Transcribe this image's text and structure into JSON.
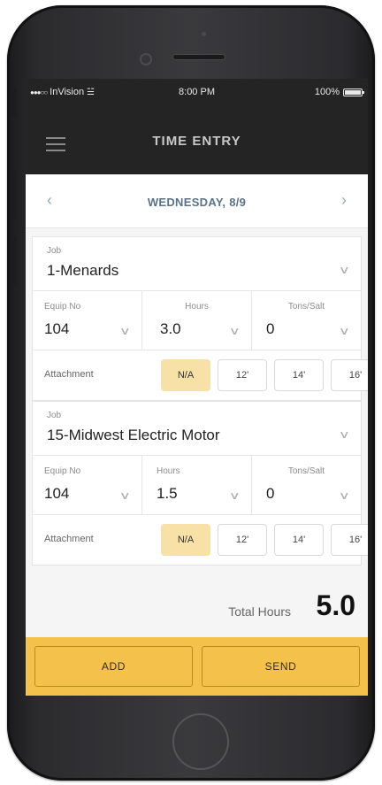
{
  "status_bar": {
    "carrier": "InVision",
    "signal_glyph": "●●●○○",
    "time": "8:00 PM",
    "battery": "100%"
  },
  "nav": {
    "title": "TIME ENTRY",
    "menu_icon": "hamburger-menu-icon"
  },
  "date_row": {
    "label": "WEDNESDAY, 8/9",
    "prev_glyph": "‹",
    "next_glyph": "›"
  },
  "entries": [
    {
      "job_label": "Job",
      "job_value": "1-Menards",
      "equip_label": "Equip No",
      "equip_value": "104",
      "hours_label": "Hours",
      "hours_value": "3.0",
      "tons_label": "Tons/Salt",
      "tons_value": "0",
      "attachment_label": "Attachment",
      "options": [
        "N/A",
        "12'",
        "14'",
        "16'"
      ],
      "selected": "N/A"
    },
    {
      "job_label": "Job",
      "job_value": "15-Midwest Electric Motor",
      "equip_label": "Equip No",
      "equip_value": "104",
      "hours_label": "Hours",
      "hours_value": "1.5",
      "tons_label": "Tons/Salt",
      "tons_value": "0",
      "attachment_label": "Attachment",
      "options": [
        "N/A",
        "12'",
        "14'",
        "16'"
      ],
      "selected": "N/A"
    }
  ],
  "total": {
    "label": "Total Hours",
    "value": "5.0"
  },
  "actions": {
    "add_label": "ADD",
    "send_label": "SEND"
  },
  "colors": {
    "accent_yellow": "#f4c14b",
    "selected_option": "#f8e1a6",
    "header_dark": "#242424",
    "date_text": "#5b7286"
  }
}
